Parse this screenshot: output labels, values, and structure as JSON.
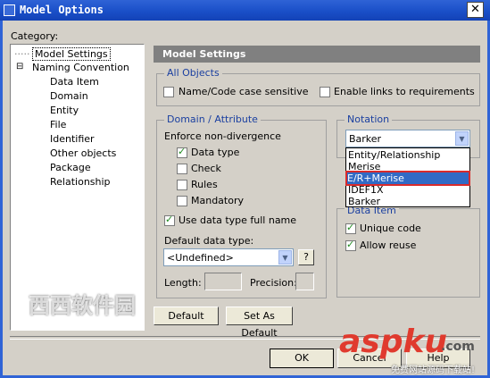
{
  "window": {
    "title": "Model Options",
    "close_glyph": "✕"
  },
  "category_label": "Category:",
  "tree": {
    "items": [
      {
        "label": "Model Settings",
        "selected": true
      },
      {
        "label": "Naming Convention"
      },
      {
        "label": "Data Item"
      },
      {
        "label": "Domain"
      },
      {
        "label": "Entity"
      },
      {
        "label": "File"
      },
      {
        "label": "Identifier"
      },
      {
        "label": "Other objects"
      },
      {
        "label": "Package"
      },
      {
        "label": "Relationship"
      }
    ],
    "expander_glyph": "⊟"
  },
  "panel": {
    "header": "Model Settings"
  },
  "all_objects": {
    "title": "All Objects",
    "name_code_case": "Name/Code case sensitive",
    "enable_links": "Enable links to requirements"
  },
  "domain_attribute": {
    "title": "Domain / Attribute",
    "enforce_label": "Enforce non-divergence",
    "data_type": "Data type",
    "check": "Check",
    "rules": "Rules",
    "mandatory": "Mandatory",
    "use_full_name": "Use data type full name",
    "default_data_type_label": "Default data type:",
    "default_data_type_value": "<Undefined>",
    "help_glyph": "?",
    "length_label": "Length:",
    "precision_label": "Precision:"
  },
  "notation": {
    "title": "Notation",
    "selected": "Barker",
    "options": [
      "Entity/Relationship",
      "Merise",
      "E/R+Merise",
      "IDEF1X",
      "Barker"
    ]
  },
  "data_item": {
    "title": "Data Item",
    "unique_code": "Unique code",
    "allow_reuse": "Allow reuse"
  },
  "buttons": {
    "default": "Default",
    "set_as_default": "Set As Default",
    "ok": "OK",
    "cancel": "Cancel",
    "help": "Help"
  },
  "watermarks": {
    "left": "西西软件园",
    "right": "aspku",
    "right_suffix": ".com",
    "right_sub": "免费网站源码下载站!"
  },
  "colors": {
    "titlebar": "#1a4fc8",
    "selection": "#316ac5",
    "highlight_border": "#d92b2b",
    "group_title": "#1a3fa0"
  }
}
